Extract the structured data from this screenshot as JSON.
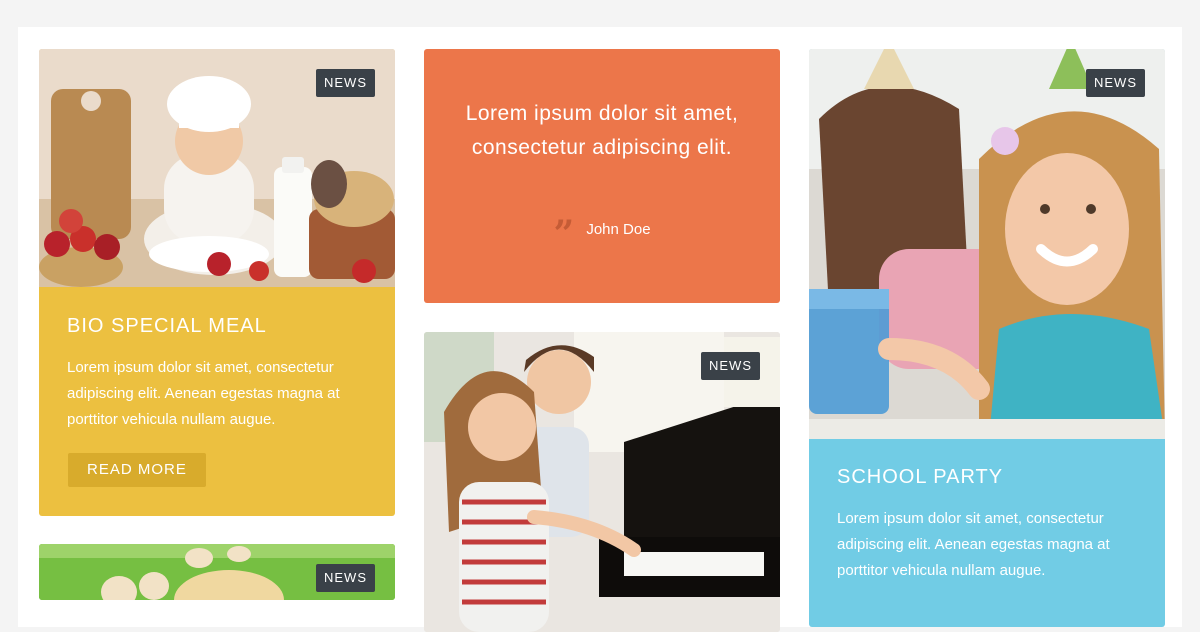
{
  "colors": {
    "page_background": "#f4f4f4",
    "yellow_card": "#ecc040",
    "orange_quote": "#ec764a",
    "blue_card": "#71cce5",
    "badge": "#3a4148",
    "read_more_button": "#d8ab2c"
  },
  "cards": {
    "bio_meal": {
      "badge": "NEWS",
      "title": "BIO SPECIAL MEAL",
      "text": "Lorem ipsum dolor sit amet, consectetur adipiscing elit. Aenean egestas magna at porttitor vehicula nullam augue.",
      "button_label": "READ MORE"
    },
    "quote": {
      "text": "Lorem ipsum dolor sit amet, consectetur adipiscing elit.",
      "quote_icon": "quote-icon",
      "author": "John Doe"
    },
    "piano": {
      "badge": "NEWS"
    },
    "school_party": {
      "badge": "NEWS",
      "title": "SCHOOL PARTY",
      "text": "Lorem ipsum dolor sit amet, consectetur adipiscing elit. Aenean egestas magna at porttitor vehicula nullam augue."
    },
    "grass_kids": {
      "badge": "NEWS"
    }
  }
}
